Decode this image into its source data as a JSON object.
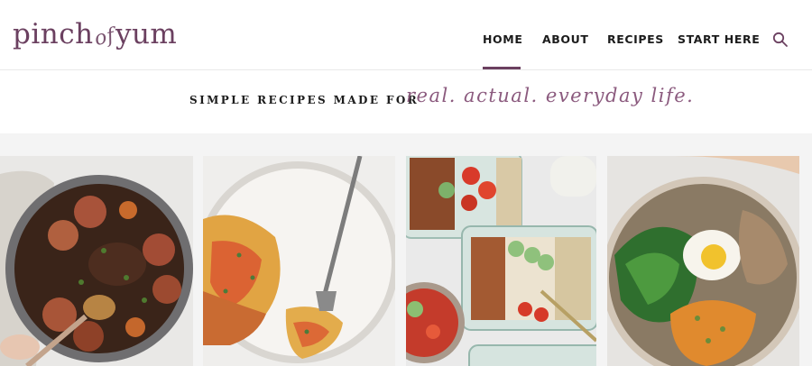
{
  "brand": {
    "logo_pinch": "pinch",
    "logo_of": "of",
    "logo_yum": "yum"
  },
  "nav": {
    "items": [
      {
        "label": "HOME",
        "active": true
      },
      {
        "label": "ABOUT"
      },
      {
        "label": "RECIPES"
      },
      {
        "label": "START HERE"
      }
    ],
    "search_icon": "search-icon"
  },
  "tagline": {
    "prefix": "SIMPLE RECIPES MADE FOR",
    "script": "real. actual. everyday life."
  },
  "gallery": {
    "images": [
      {
        "icon": "beef-stew-image"
      },
      {
        "icon": "lasagna-plate-image"
      },
      {
        "icon": "meal-prep-containers-image"
      },
      {
        "icon": "salad-bowl-image"
      }
    ]
  },
  "colors": {
    "brand": "#6b4060",
    "script": "#8b5a7e",
    "text": "#1c1c1c",
    "gallery_bg": "#f4f4f4"
  }
}
